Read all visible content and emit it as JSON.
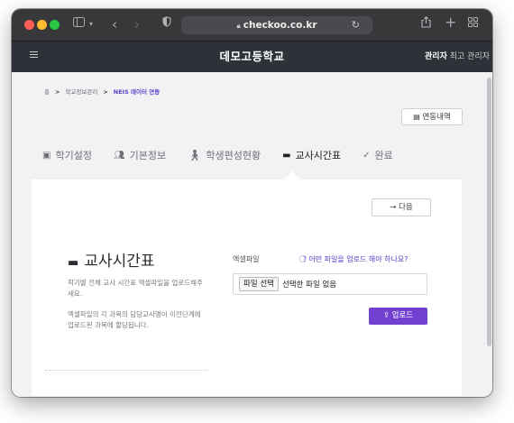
{
  "browser": {
    "url": "checkoo.co.kr"
  },
  "header": {
    "school_name": "데모고등학교",
    "user_role": "관리자",
    "user_name": "최고 관리자"
  },
  "breadcrumb": {
    "home": "홈",
    "sep1": ">",
    "item1": "학교정보관리",
    "sep2": ">",
    "current": "NEIS 데이터 연동"
  },
  "history_button": "연동내역",
  "tabs": [
    {
      "label": "학기설정",
      "icon": "calendar-icon"
    },
    {
      "label": "기본정보",
      "icon": "users-icon"
    },
    {
      "label": "학생편성현황",
      "icon": "student-icon"
    },
    {
      "label": "교사시간표",
      "icon": "teacher-icon"
    },
    {
      "label": "완료",
      "icon": "check-icon"
    }
  ],
  "active_tab": "교사시간표",
  "panel": {
    "next_button": "→ 다음",
    "title": "교사시간표",
    "description1": "학기별 전체 교사 시간표 엑셀파일을 업로드해주세요.",
    "description2": "엑셀파일의 각 과목의 담당교사명이 이전단계에 업로드된 과목에 할당됩니다.",
    "field_label": "엑셀파일",
    "help_link": "어떤 파일을 업로드 해야 하나요?",
    "file_button": "파일 선택",
    "file_status": "선택한 파일 없음",
    "upload_button": "업로드"
  },
  "colors": {
    "accent": "#7140d0",
    "header_bg": "#2d3238",
    "chrome_bg": "#38383b"
  }
}
